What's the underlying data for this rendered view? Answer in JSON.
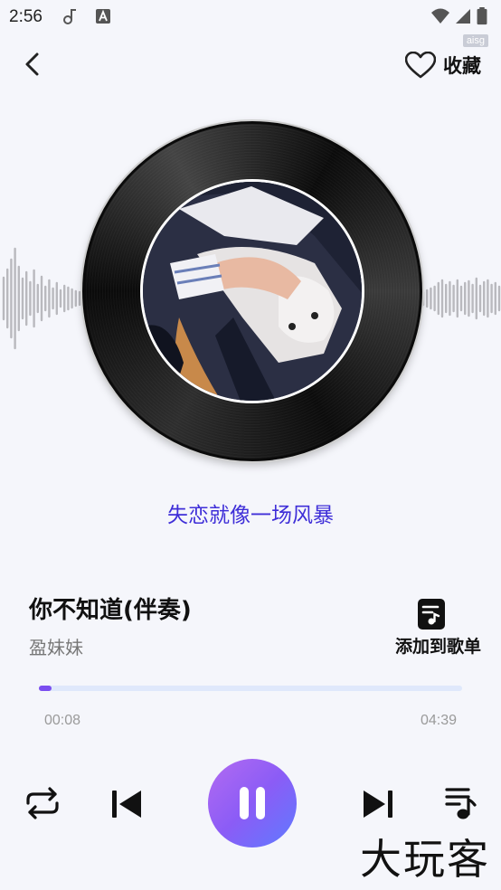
{
  "status_bar": {
    "time": "2:56",
    "badge": "aisg"
  },
  "header": {
    "favorite_label": "收藏"
  },
  "lyric": {
    "current_line": "失恋就像一场风暴"
  },
  "song": {
    "title": "你不知道(伴奏)",
    "artist": "盈妹妹"
  },
  "add_to_playlist": {
    "label": "添加到歌单"
  },
  "progress": {
    "current": "00:08",
    "total": "04:39",
    "fraction": 0.03
  },
  "watermark": "大玩客",
  "colors": {
    "accent": "#3f2fd8",
    "progress": "#7b4ef0",
    "play_gradient_start": "#b36bf1",
    "play_gradient_end": "#5e7bff"
  }
}
